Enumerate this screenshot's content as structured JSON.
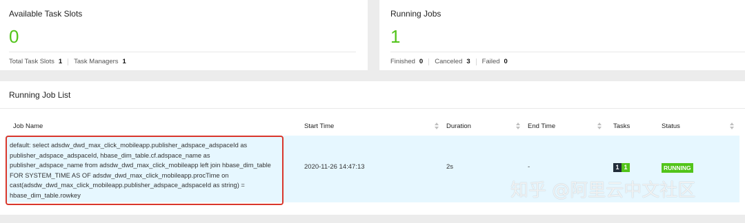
{
  "available_slots": {
    "title": "Available Task Slots",
    "value": "0",
    "total_label": "Total Task Slots",
    "total_value": "1",
    "managers_label": "Task Managers",
    "managers_value": "1"
  },
  "running_jobs": {
    "title": "Running Jobs",
    "value": "1",
    "finished_label": "Finished",
    "finished_value": "0",
    "canceled_label": "Canceled",
    "canceled_value": "3",
    "failed_label": "Failed",
    "failed_value": "0"
  },
  "job_list": {
    "title": "Running Job List",
    "columns": {
      "job_name": "Job Name",
      "start_time": "Start Time",
      "duration": "Duration",
      "end_time": "End Time",
      "tasks": "Tasks",
      "status": "Status"
    },
    "rows": [
      {
        "job_name": "default: select adsdw_dwd_max_click_mobileapp.publisher_adspace_adspaceId as publisher_adspace_adspaceId, hbase_dim_table.cf.adspace_name as publisher_adspace_name from adsdw_dwd_max_click_mobileapp left join hbase_dim_table FOR SYSTEM_TIME AS OF adsdw_dwd_max_click_mobileapp.procTime on cast(adsdw_dwd_max_click_mobileapp.publisher_adspace_adspaceId as string) = hbase_dim_table.rowkey",
        "start_time": "2020-11-26 14:47:13",
        "duration": "2s",
        "end_time": "-",
        "tasks_a": "1",
        "tasks_b": "1",
        "status": "RUNNING"
      }
    ]
  },
  "watermark": "知乎 @阿里云中文社区",
  "colors": {
    "accent_green": "#52c41a",
    "row_highlight": "#e6f7ff",
    "annotation_red": "#d9362b"
  }
}
